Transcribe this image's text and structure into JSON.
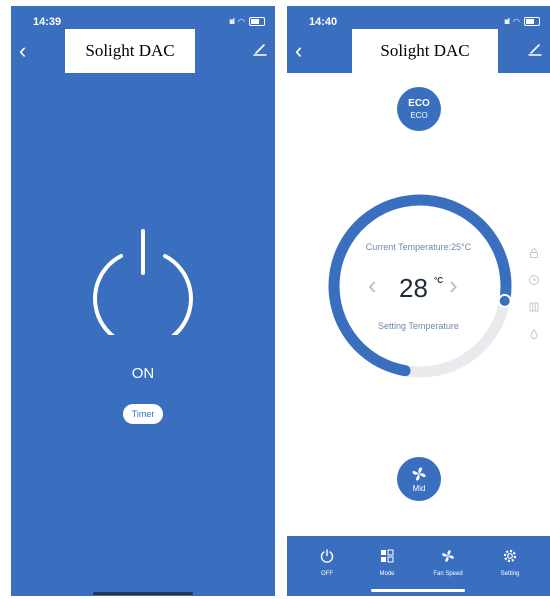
{
  "left_screen": {
    "status": {
      "time": "14:39"
    },
    "header": {
      "title": "Solight DAC"
    },
    "power": {
      "state_label": "ON"
    },
    "timer": {
      "label": "Timer"
    }
  },
  "right_screen": {
    "status": {
      "time": "14:40"
    },
    "header": {
      "title": "Solight DAC"
    },
    "eco": {
      "icon_text": "ECO",
      "label": "ECO"
    },
    "thermostat": {
      "current_temperature_label": "Current Temperature:25°C",
      "setpoint_value": "28",
      "setpoint_unit": "°C",
      "setting_label": "Setting Temperature",
      "dial_fraction": 0.75
    },
    "fan": {
      "speed_label": "Mid"
    },
    "side_icons": [
      "lock-icon",
      "clock-icon",
      "grid-icon",
      "drop-icon"
    ],
    "bottom_nav": [
      {
        "label": "OFF",
        "icon": "power-icon"
      },
      {
        "label": "Mode",
        "icon": "mode-icon"
      },
      {
        "label": "Fan Speed",
        "icon": "fan-icon"
      },
      {
        "label": "Setting",
        "icon": "gear-icon"
      }
    ]
  },
  "colors": {
    "accent": "#3a6fc0",
    "track": "#e8eaee",
    "muted_text": "#6f86ad"
  }
}
